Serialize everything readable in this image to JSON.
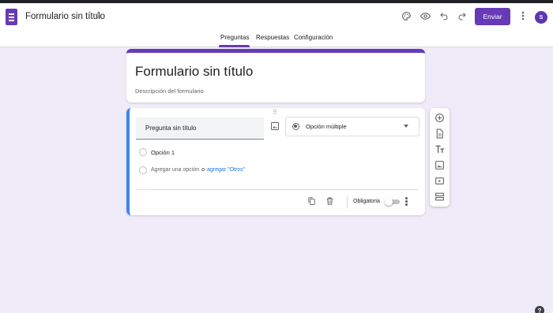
{
  "header": {
    "doc_title": "Formulario sin título",
    "send_label": "Enviar",
    "avatar_initial": "S"
  },
  "tabs": [
    {
      "label": "Preguntas",
      "active": true
    },
    {
      "label": "Respuestas",
      "active": false
    },
    {
      "label": "Configuración",
      "active": false
    }
  ],
  "form": {
    "title": "Formulario sin título",
    "description_placeholder": "Descripción del formulario"
  },
  "question": {
    "title_placeholder": "Pregunta sin título",
    "type_label": "Opción múltiple",
    "options": [
      "Opción 1"
    ],
    "add_option_label": "Agregar una opción",
    "or_label": "o",
    "add_other_label": "agregar \"Otros\"",
    "required_label": "Obligatoria",
    "required": false
  },
  "colors": {
    "accent": "#673ab7",
    "background": "#f0ebf8",
    "question_focus": "#4285f4",
    "link": "#1a73e8"
  },
  "icons": {
    "header": [
      "palette-icon",
      "eye-icon",
      "undo-icon",
      "redo-icon",
      "more-vert-icon"
    ],
    "side_toolbar": [
      "add-circle-icon",
      "import-icon",
      "title-icon",
      "image-icon",
      "video-icon",
      "section-icon"
    ],
    "footer": [
      "copy-icon",
      "trash-icon",
      "more-vert-icon"
    ]
  }
}
